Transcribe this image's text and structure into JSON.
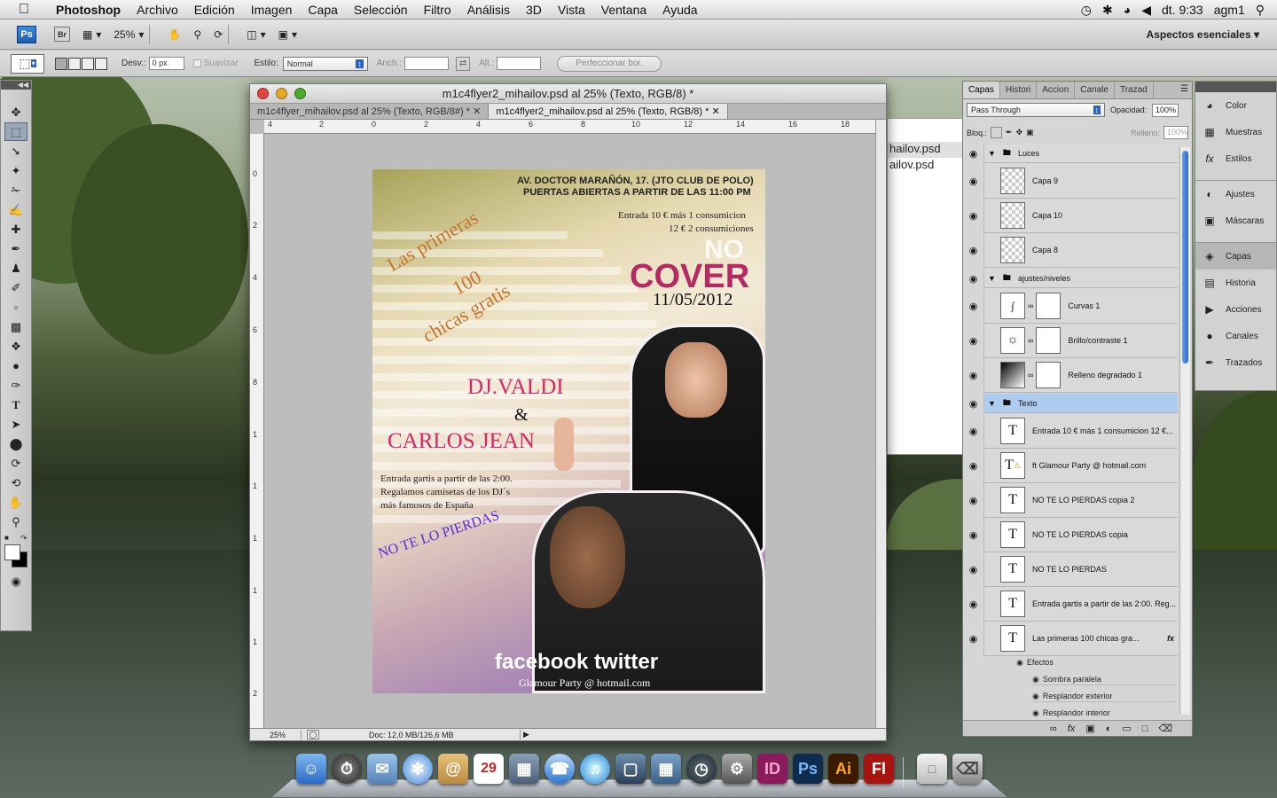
{
  "menubar": {
    "app_name": "Photoshop",
    "items": [
      "Archivo",
      "Edición",
      "Imagen",
      "Capa",
      "Selección",
      "Filtro",
      "Análisis",
      "3D",
      "Vista",
      "Ventana",
      "Ayuda"
    ],
    "clock": "dt. 9:33",
    "user": "agm1"
  },
  "appbar": {
    "ps_label": "Ps",
    "br_label": "Br",
    "zoom": "25%",
    "workspace": "Aspectos esenciales"
  },
  "options": {
    "feather_label": "Desv.:",
    "feather_value": "0 px",
    "antialias_label": "Suavizar",
    "style_label": "Estilo:",
    "style_value": "Normal",
    "width_label": "Anch.:",
    "height_label": "Alt.:",
    "refine_label": "Perfeccionar bor."
  },
  "document": {
    "title": "m1c4flyer2_mihailov.psd al 25% (Texto, RGB/8) *",
    "tabs": [
      "m1c4flyer_mihailov.psd al 25% (Texto, RGB/8#) *",
      "m1c4flyer2_mihailov.psd al 25% (Texto, RGB/8) *"
    ],
    "hruler": [
      "4",
      "2",
      "0",
      "2",
      "4",
      "6",
      "8",
      "10",
      "12",
      "14",
      "16",
      "18"
    ],
    "vruler": [
      "0",
      "2",
      "4",
      "6",
      "8",
      "1",
      "1",
      "1",
      "1",
      "1",
      "2"
    ],
    "status_zoom": "25%",
    "status_doc": "Doc: 12,0 MB/126,6 MB"
  },
  "poster": {
    "address1": "AV. DOCTOR MARAÑÓN, 17. (JTO CLUB DE POLO)",
    "address2": "PUERTAS ABIERTAS A PARTIR DE LAS 11:00 PM",
    "entry1": "Entrada 10 € más 1 consumicion",
    "entry2": "12 € 2 consumiciones",
    "no": "NO",
    "cover": "COVER",
    "date": "11/05/2012",
    "promo1": "Las primeras",
    "promo2": "100",
    "promo3": "chicas gratis",
    "dj1": "DJ.VALDI",
    "amp": "&",
    "dj2": "CARLOS JEAN",
    "free1": "Entrada gartis a partir de las 2:00.",
    "free2": "Regalamos camisetas de los DJ´s",
    "free3": "más famosos de España",
    "missit": "NO TE LO PIERDAS",
    "social": "facebook twitter",
    "email": "Glamour Party @ hotmail.com"
  },
  "peek": {
    "line1": "hailov.psd",
    "line2": "ailov.psd"
  },
  "layers_panel": {
    "tabs": [
      "Capas",
      "Histori",
      "Accion",
      "Canale",
      "Trazad"
    ],
    "blend": "Pass Through",
    "opacity_label": "Opacidad:",
    "opacity": "100%",
    "lock_label": "Bloq.:",
    "fill_label": "Relleno:",
    "fill": "100%",
    "layers": [
      {
        "name": "Luces",
        "kind": "group"
      },
      {
        "name": "Capa 9",
        "kind": "pixel"
      },
      {
        "name": "Capa 10",
        "kind": "pixel"
      },
      {
        "name": "Capa 8",
        "kind": "pixel"
      },
      {
        "name": "ajustes/niveles",
        "kind": "group"
      },
      {
        "name": "Curvas 1",
        "kind": "adjust"
      },
      {
        "name": "Brillo/contraste 1",
        "kind": "adjust"
      },
      {
        "name": "Relleno degradado 1",
        "kind": "adjust"
      },
      {
        "name": "Texto",
        "kind": "group"
      },
      {
        "name": "Entrada 10 € más 1 consumicion 12 €...",
        "kind": "text"
      },
      {
        "name": "ft        Glamour Party @ hotmail.com",
        "kind": "text"
      },
      {
        "name": "NO TE LO PIERDAS copia 2",
        "kind": "text"
      },
      {
        "name": "NO TE LO PIERDAS copia",
        "kind": "text"
      },
      {
        "name": "NO TE LO PIERDAS",
        "kind": "text"
      },
      {
        "name": "Entrada gartis a partir de las 2:00. Reg...",
        "kind": "text"
      },
      {
        "name": "Las primeras     100  chicas gra...",
        "kind": "text"
      }
    ],
    "effects_label": "Efectos",
    "effects": [
      "Sombra paralela",
      "Resplandor exterior",
      "Resplandor interior"
    ]
  },
  "side_dock": {
    "group1": [
      "Color",
      "Muestras",
      "Estilos"
    ],
    "group2": [
      "Ajustes",
      "Máscaras"
    ],
    "group3": [
      "Capas",
      "Historia",
      "Acciones",
      "Canales",
      "Trazados"
    ]
  },
  "dock": {
    "calendar_day": "29",
    "id_label": "ID",
    "ps_label": "Ps",
    "ai_label": "Ai",
    "fl_label": "Fl"
  }
}
